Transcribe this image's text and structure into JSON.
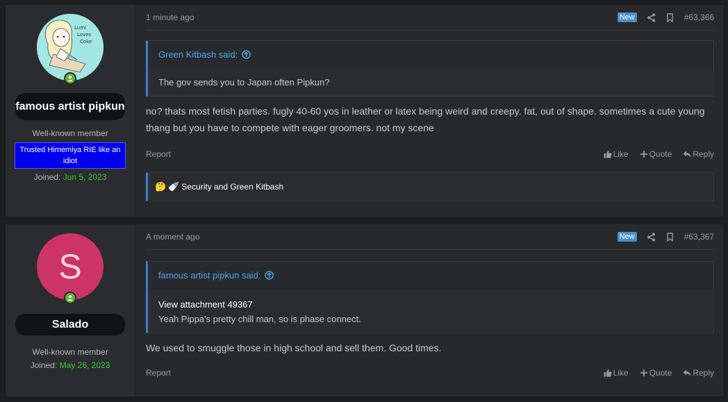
{
  "posts": [
    {
      "username": "famous artist pipkun",
      "user_title": "Well-known member",
      "banner": "Trusted Himemiya RIE like an idiot",
      "joined_label": "Joined:",
      "joined_date": "Jun 5, 2023",
      "time": "1 minute ago",
      "badge": "New",
      "post_number": "#63,366",
      "quote_author": "Green Kitbash said:",
      "quote_text": "The gov sends you to Japan often Pipkun?",
      "message": "no? thats most fetish parties. fugly 40-60 yos in leather or latex being weird and creepy. fat, out of shape. sometimes a cute young thang but you have to compete with eager groomers. not my scene",
      "report": "Report",
      "like": "Like",
      "quote": "Quote",
      "reply": "Reply",
      "reactions": "Security and Green Kitbash"
    },
    {
      "username": "Salado",
      "avatar_letter": "S",
      "user_title": "Well-known member",
      "joined_label": "Joined:",
      "joined_date": "May 26, 2023",
      "time": "A moment ago",
      "badge": "New",
      "post_number": "#63,367",
      "quote_author": "famous artist pipkun said:",
      "quote_attachment": "View attachment 49367",
      "quote_text": "Yeah Pippa's pretty chill man, so is phase connect.",
      "message": "We used to smuggle those in high school and sell them. Good times.",
      "report": "Report",
      "like": "Like",
      "quote": "Quote",
      "reply": "Reply"
    }
  ],
  "colors": {
    "link": "#47a7eb",
    "accent_border": "#3c7fd0",
    "badge": "#4a90c8",
    "online": "#63b53b",
    "joined_date": "#33cc33",
    "banner_bg": "#0000ee",
    "avatar_s_bg": "#cc3366"
  },
  "avatar_text": [
    "Lumi",
    "Loves",
    "Coke"
  ]
}
